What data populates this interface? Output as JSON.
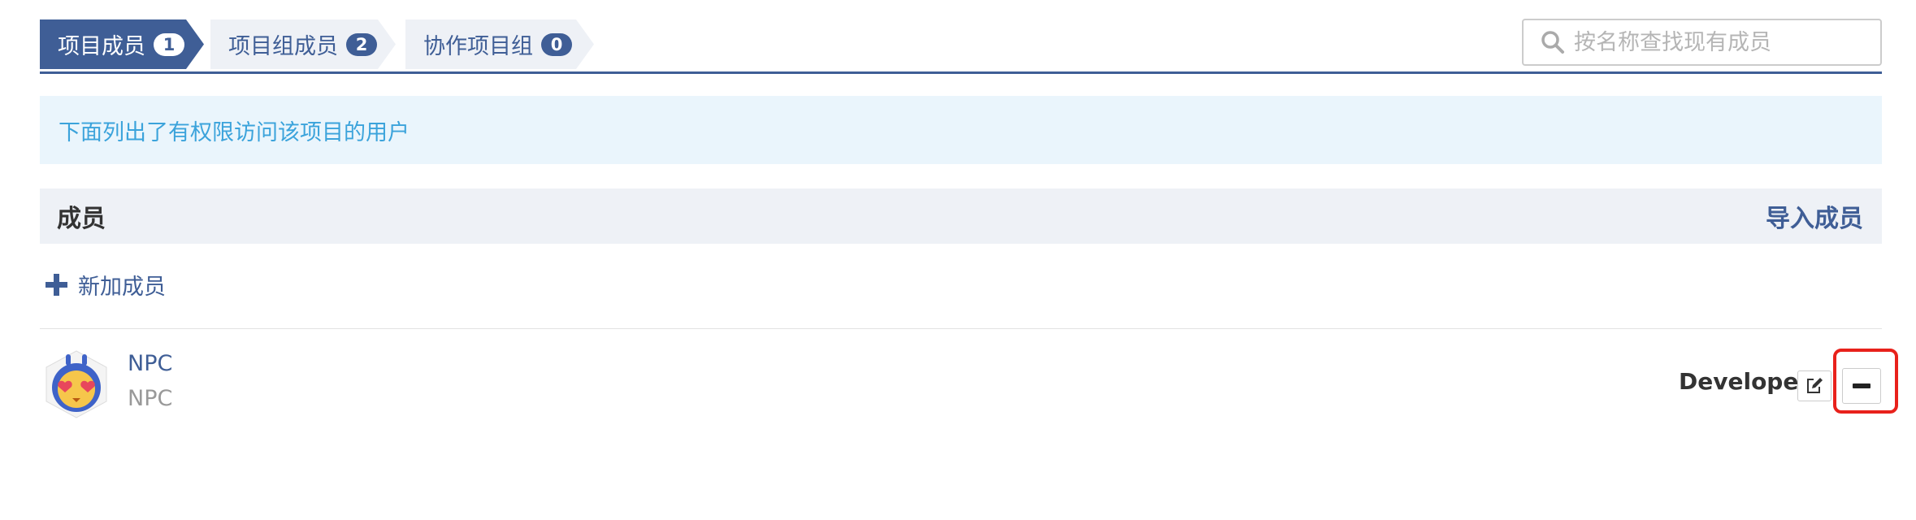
{
  "tabs": [
    {
      "label": "项目成员",
      "count": "1",
      "active": true
    },
    {
      "label": "项目组成员",
      "count": "2",
      "active": false
    },
    {
      "label": "协作项目组",
      "count": "0",
      "active": false
    }
  ],
  "search": {
    "placeholder": "按名称查找现有成员",
    "value": "",
    "icon": "search-icon"
  },
  "info_banner": {
    "text": "下面列出了有权限访问该项目的用户"
  },
  "section": {
    "title": "成员",
    "import_label": "导入成员"
  },
  "add_member": {
    "label": "新加成员",
    "icon": "plus-icon"
  },
  "members": [
    {
      "name": "NPC",
      "username": "NPC",
      "role": "Developer",
      "avatar": "avatar-emoji-heart-eyes",
      "edit_icon": "edit-icon",
      "remove_icon": "minus-icon"
    }
  ],
  "colors": {
    "primary": "#3f5e96",
    "info_text": "#3ba3db",
    "info_background": "#eaf5fc",
    "section_background": "#eef1f6",
    "highlight": "#e8211b"
  }
}
